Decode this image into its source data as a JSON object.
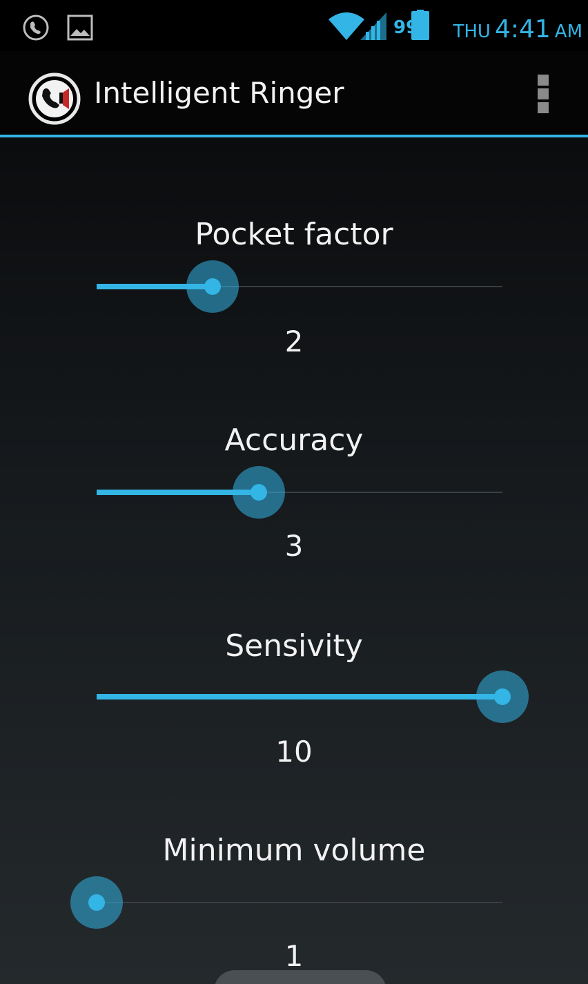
{
  "status_bar": {
    "left_icons": [
      "missed-call-icon",
      "image-icon"
    ],
    "right_icons": [
      "wifi-icon",
      "signal-icon",
      "battery-icon"
    ],
    "battery_level": "99",
    "day": "THU",
    "time": "4:41",
    "ampm": "AM"
  },
  "action_bar": {
    "title": "Intelligent Ringer",
    "app_icon": "phone-speaker-icon",
    "menu_icon": "overflow-menu-icon"
  },
  "settings": [
    {
      "label": "Pocket factor",
      "value": "2",
      "level": 0.286
    },
    {
      "label": "Accuracy",
      "value": "3",
      "level": 0.4
    },
    {
      "label": "Sensivity",
      "value": "10",
      "level": 1.0
    },
    {
      "label": "Minimum volume",
      "value": "1",
      "level": 0.0
    }
  ],
  "colors": {
    "accent": "#33b5e5",
    "text": "#f2f2f2",
    "background": "#161a1d"
  }
}
